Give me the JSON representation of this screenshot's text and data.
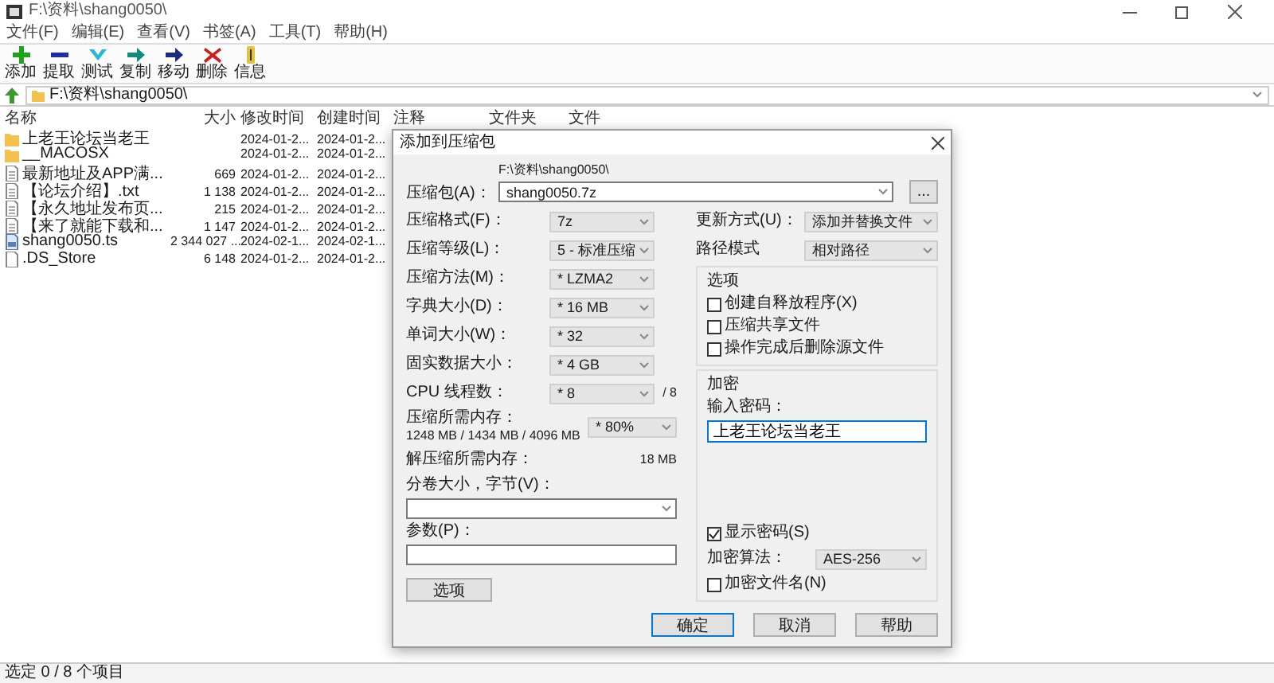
{
  "window": {
    "title": "F:\\资料\\shang0050\\"
  },
  "menu": [
    "文件(F)",
    "编辑(E)",
    "查看(V)",
    "书签(A)",
    "工具(T)",
    "帮助(H)"
  ],
  "toolbar": [
    {
      "label": "添加",
      "kind": "add"
    },
    {
      "label": "提取",
      "kind": "extract"
    },
    {
      "label": "测试",
      "kind": "test"
    },
    {
      "label": "复制",
      "kind": "copy"
    },
    {
      "label": "移动",
      "kind": "move"
    },
    {
      "label": "删除",
      "kind": "delete"
    },
    {
      "label": "信息",
      "kind": "info"
    }
  ],
  "address_bar": {
    "path": "F:\\资料\\shang0050\\"
  },
  "file_list": {
    "columns": [
      "名称",
      "大小",
      "修改时间",
      "创建时间",
      "注释",
      "文件夹",
      "文件"
    ],
    "rows": [
      {
        "kind": "folder",
        "name": "上老王论坛当老王",
        "modified": "2024-01-2...",
        "created": "2024-01-2..."
      },
      {
        "kind": "folder",
        "name": "__MACOSX",
        "modified": "2024-01-2...",
        "created": "2024-01-2..."
      },
      {
        "kind": "text",
        "name": "最新地址及APP满...",
        "size": "669",
        "modified": "2024-01-2...",
        "created": "2024-01-2..."
      },
      {
        "kind": "text",
        "name": "【论坛介绍】.txt",
        "size": "1 138",
        "modified": "2024-01-2...",
        "created": "2024-01-2..."
      },
      {
        "kind": "text",
        "name": "【永久地址发布页...",
        "size": "215",
        "modified": "2024-01-2...",
        "created": "2024-01-2..."
      },
      {
        "kind": "text",
        "name": "【来了就能下载和...",
        "size": "1 147",
        "modified": "2024-01-2...",
        "created": "2024-01-2..."
      },
      {
        "kind": "video",
        "name": "shang0050.ts",
        "size": "2 344 027 ...",
        "modified": "2024-02-1...",
        "created": "2024-02-1..."
      },
      {
        "kind": "file",
        "name": ".DS_Store",
        "size": "6 148",
        "modified": "2024-01-2...",
        "created": "2024-01-2..."
      }
    ]
  },
  "dialog": {
    "title": "添加到压缩包",
    "archive": {
      "label": "压缩包(A)：",
      "folder": "F:\\资料\\shang0050\\",
      "value": "shang0050.7z",
      "browse": "..."
    },
    "settings": [
      {
        "label": "压缩格式(F)：",
        "value": "7z"
      },
      {
        "label": "压缩等级(L)：",
        "value": "5 - 标准压缩"
      },
      {
        "label": "压缩方法(M)：",
        "value": "* LZMA2"
      },
      {
        "label": "字典大小(D)：",
        "value": "* 16 MB"
      },
      {
        "label": "单词大小(W)：",
        "value": "* 32"
      },
      {
        "label": "固实数据大小：",
        "value": "* 4 GB"
      },
      {
        "label": "CPU 线程数：",
        "value": "* 8",
        "suffix": "/ 8"
      }
    ],
    "memory": {
      "label": "压缩所需内存：",
      "detail": "1248 MB / 1434 MB / 4096 MB",
      "value": "* 80%"
    },
    "decompress": {
      "label": "解压缩所需内存：",
      "value": "18 MB"
    },
    "split": {
      "label": "分卷大小，字节(V)："
    },
    "params": {
      "label": "参数(P)："
    },
    "options_button": "选项",
    "right_settings": [
      {
        "label": "更新方式(U)：",
        "value": "添加并替换文件"
      },
      {
        "label": "路径模式",
        "value": "相对路径"
      }
    ],
    "options_group": {
      "title": "选项",
      "items": [
        {
          "label": "创建自释放程序(X)",
          "checked": false
        },
        {
          "label": "压缩共享文件",
          "checked": false
        },
        {
          "label": "操作完成后删除源文件",
          "checked": false
        }
      ]
    },
    "encryption": {
      "title": "加密",
      "password_label": "输入密码：",
      "password": "上老王论坛当老王",
      "show_password": {
        "label": "显示密码(S)",
        "checked": true
      },
      "method_label": "加密算法：",
      "method": "AES-256",
      "encrypt_names": {
        "label": "加密文件名(N)",
        "checked": false
      }
    },
    "buttons": [
      {
        "label": "确定",
        "default": true
      },
      {
        "label": "取消",
        "default": false
      },
      {
        "label": "帮助",
        "default": false
      }
    ]
  },
  "status_bar": "选定 0 / 8 个项目"
}
